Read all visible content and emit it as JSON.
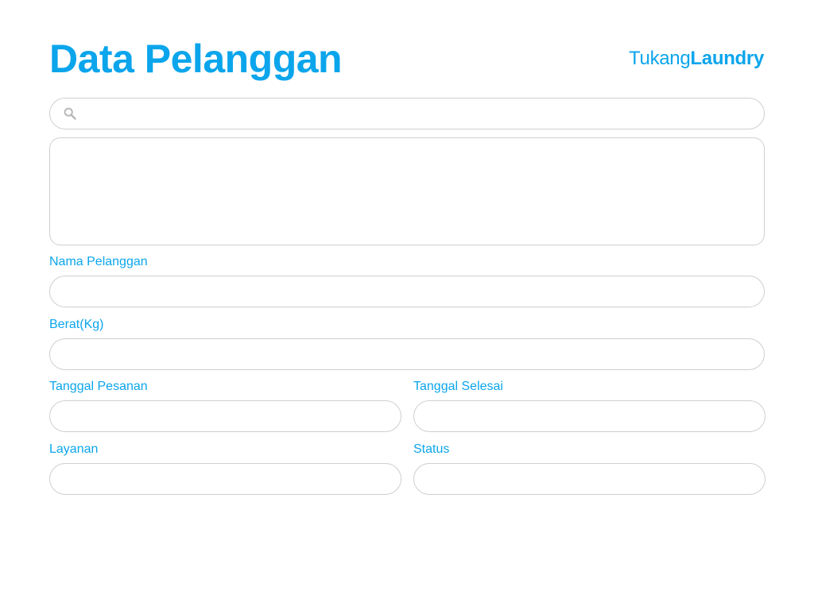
{
  "header": {
    "title": "Data Pelanggan",
    "brand_light": "Tukang",
    "brand_bold": "Laundry"
  },
  "search": {
    "icon": "search-icon",
    "value": "",
    "placeholder": ""
  },
  "form": {
    "nama_pelanggan": {
      "label": "Nama Pelanggan",
      "value": ""
    },
    "berat": {
      "label": "Berat(Kg)",
      "value": ""
    },
    "tanggal_pesanan": {
      "label": "Tanggal Pesanan",
      "value": ""
    },
    "tanggal_selesai": {
      "label": "Tanggal Selesai",
      "value": ""
    },
    "layanan": {
      "label": "Layanan",
      "value": ""
    },
    "status": {
      "label": "Status",
      "value": ""
    }
  },
  "colors": {
    "accent": "#0ba5ec",
    "border": "#cfcfcf",
    "icon": "#b8b8b8"
  }
}
